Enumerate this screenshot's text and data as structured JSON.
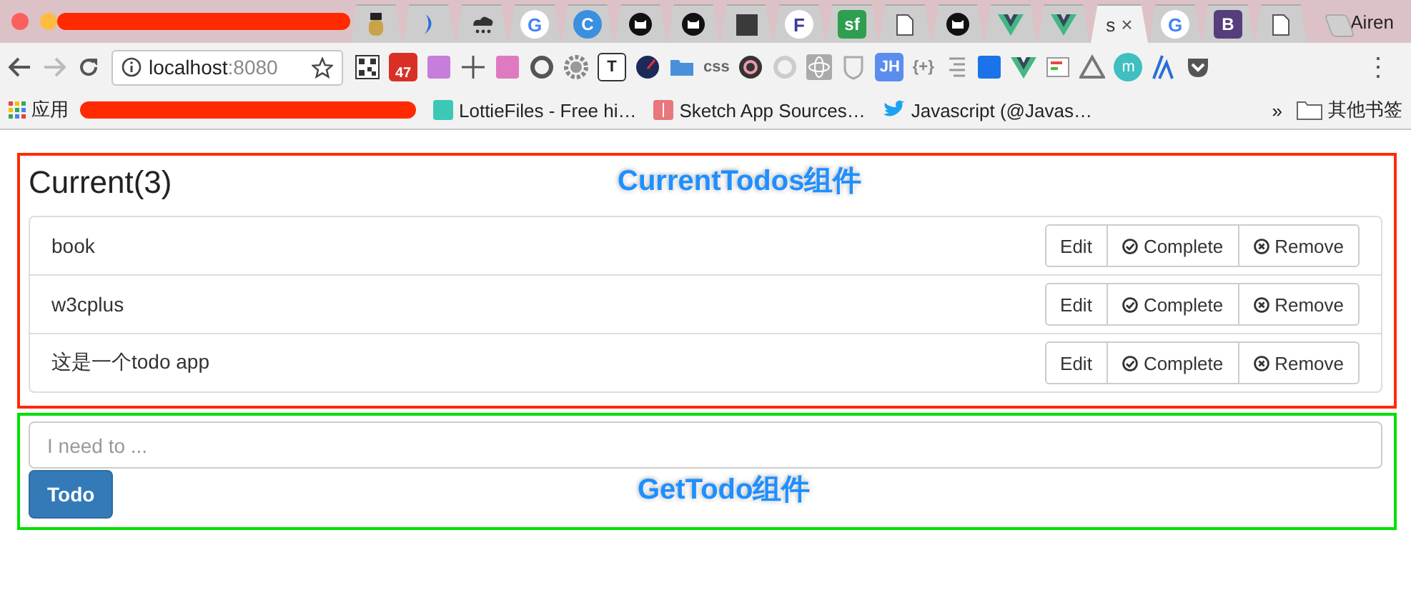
{
  "browser": {
    "tabs": [
      {
        "kind": "figure",
        "selected": false
      },
      {
        "kind": "crescent",
        "color": "#2a6fd6",
        "selected": false
      },
      {
        "kind": "cloud",
        "selected": false
      },
      {
        "kind": "letter",
        "glyph": "G",
        "color": "#4285f4",
        "selected": false
      },
      {
        "kind": "letter-circle",
        "glyph": "C",
        "color": "#3b8fe0",
        "selected": false
      },
      {
        "kind": "cat",
        "selected": false
      },
      {
        "kind": "cat",
        "selected": false
      },
      {
        "kind": "square",
        "color": "#3a3a3a",
        "selected": false
      },
      {
        "kind": "letter",
        "glyph": "F",
        "color": "#3b3b9e",
        "selected": false
      },
      {
        "kind": "letter-tile",
        "glyph": "sf",
        "color": "#2e9e4f",
        "selected": false
      },
      {
        "kind": "doc",
        "selected": false
      },
      {
        "kind": "cat",
        "selected": false
      },
      {
        "kind": "vue",
        "selected": false
      },
      {
        "kind": "vue",
        "selected": false
      },
      {
        "kind": "text",
        "glyph": "s",
        "close": "×",
        "selected": true
      },
      {
        "kind": "letter",
        "glyph": "G",
        "color": "#4285f4",
        "selected": false
      },
      {
        "kind": "letter-tile",
        "glyph": "B",
        "color": "#563d7c",
        "selected": false
      },
      {
        "kind": "doc",
        "selected": false
      }
    ],
    "profile": "Airen",
    "address": {
      "host": "localhost",
      "port": ":8080"
    },
    "extensions": [
      {
        "kind": "grid"
      },
      {
        "kind": "badge",
        "glyph": "47",
        "color": "#d93025"
      },
      {
        "kind": "tile",
        "color": "#c77ddb"
      },
      {
        "kind": "cross"
      },
      {
        "kind": "tile",
        "color": "#e07ac0"
      },
      {
        "kind": "ring",
        "color": "#555555"
      },
      {
        "kind": "gear"
      },
      {
        "kind": "boxed",
        "glyph": "T"
      },
      {
        "kind": "gauge"
      },
      {
        "kind": "folder",
        "color": "#4a90d9"
      },
      {
        "kind": "text",
        "glyph": "css",
        "color": "#666666"
      },
      {
        "kind": "circle",
        "color": "#333333"
      },
      {
        "kind": "ring",
        "color": "#cccccc"
      },
      {
        "kind": "atom"
      },
      {
        "kind": "shield"
      },
      {
        "kind": "text-tile",
        "glyph": "JH",
        "color": "#5b8def"
      },
      {
        "kind": "text",
        "glyph": "{+}",
        "color": "#888888"
      },
      {
        "kind": "list"
      },
      {
        "kind": "tile",
        "color": "#1a73e8"
      },
      {
        "kind": "vue"
      },
      {
        "kind": "note"
      },
      {
        "kind": "triangle"
      },
      {
        "kind": "letter-circle",
        "glyph": "m",
        "color": "#3fbfc0"
      },
      {
        "kind": "lines",
        "color": "#2a6fd6"
      },
      {
        "kind": "pocket"
      }
    ],
    "menu": "⋮",
    "bookmarks": {
      "apps": "应用",
      "items": [
        {
          "label": "LottieFiles - Free hi…",
          "kind": "lottie"
        },
        {
          "label": "Sketch App Sources…",
          "kind": "sketch"
        },
        {
          "label": "Javascript (@Javas…",
          "kind": "bird"
        }
      ],
      "more": "»",
      "other": "其他书签"
    }
  },
  "current_todos": {
    "color": "#ff2a00",
    "annotation": "CurrentTodos组件",
    "title": "Current(3)",
    "items": [
      {
        "text": "book",
        "actions": [
          {
            "label": "Edit",
            "kind": "plain"
          },
          {
            "label": "Complete",
            "kind": "check"
          },
          {
            "label": "Remove",
            "kind": "cross"
          }
        ]
      },
      {
        "text": "w3cplus",
        "actions": [
          {
            "label": "Edit",
            "kind": "plain"
          },
          {
            "label": "Complete",
            "kind": "check"
          },
          {
            "label": "Remove",
            "kind": "cross"
          }
        ]
      },
      {
        "text": "这是一个todo app",
        "actions": [
          {
            "label": "Edit",
            "kind": "plain"
          },
          {
            "label": "Complete",
            "kind": "check"
          },
          {
            "label": "Remove",
            "kind": "cross"
          }
        ]
      }
    ]
  },
  "get_todo": {
    "color": "#00e000",
    "annotation": "GetTodo组件",
    "placeholder": "I need to ...",
    "button": "Todo"
  }
}
